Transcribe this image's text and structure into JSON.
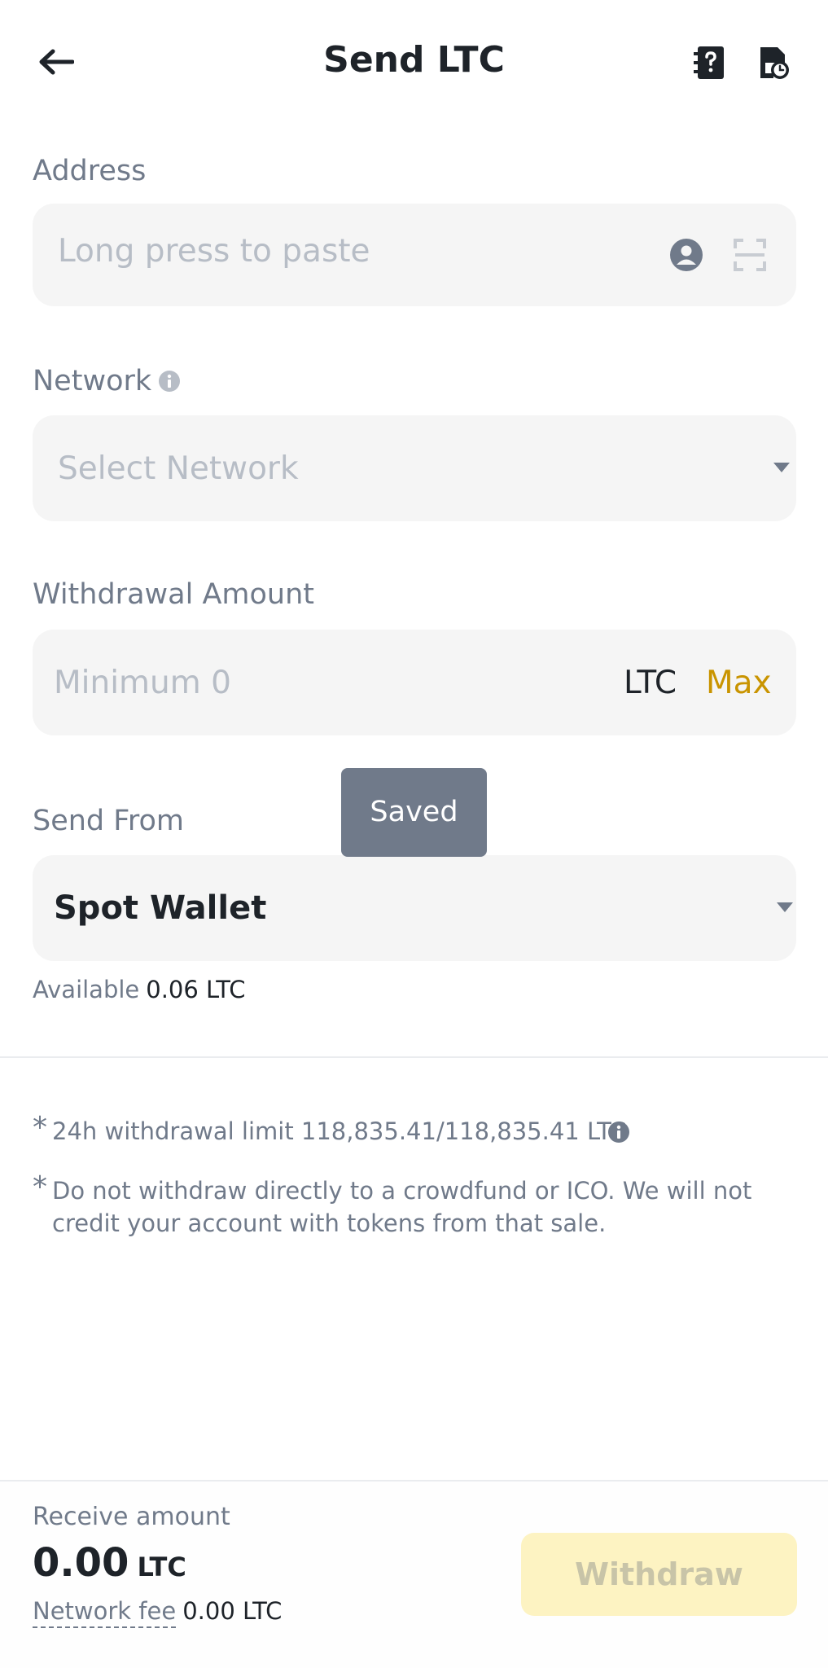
{
  "header": {
    "title": "Send LTC",
    "back_icon": "arrow-left-icon",
    "faq_icon": "faq-icon",
    "history_icon": "history-icon"
  },
  "address": {
    "label": "Address",
    "placeholder": "Long press to paste",
    "contact_icon": "contact-icon",
    "scan_icon": "scan-icon"
  },
  "network": {
    "label": "Network",
    "placeholder": "Select Network"
  },
  "amount": {
    "label": "Withdrawal Amount",
    "placeholder": "Minimum 0",
    "unit": "LTC",
    "max_label": "Max"
  },
  "toast": {
    "text": "Saved"
  },
  "send_from": {
    "label": "Send From",
    "value": "Spot Wallet",
    "available_label": "Available",
    "available_value": "0.06 LTC"
  },
  "notes": {
    "limit": "24h withdrawal limit 118,835.41/118,835.41 LTC",
    "warning": "Do not withdraw directly to a crowdfund or ICO. We will not credit your account with tokens from that sale."
  },
  "footer": {
    "receive_label": "Receive amount",
    "receive_value": "0.00",
    "receive_unit": "LTC",
    "fee_label": "Network fee",
    "fee_value": "0.00 LTC",
    "withdraw_label": "Withdraw"
  },
  "colors": {
    "accent": "#c99400",
    "button_disabled_bg": "#fdf3c2",
    "field_bg": "#f5f5f5",
    "muted_text": "#707a8a",
    "toast_bg": "#707a8a"
  }
}
